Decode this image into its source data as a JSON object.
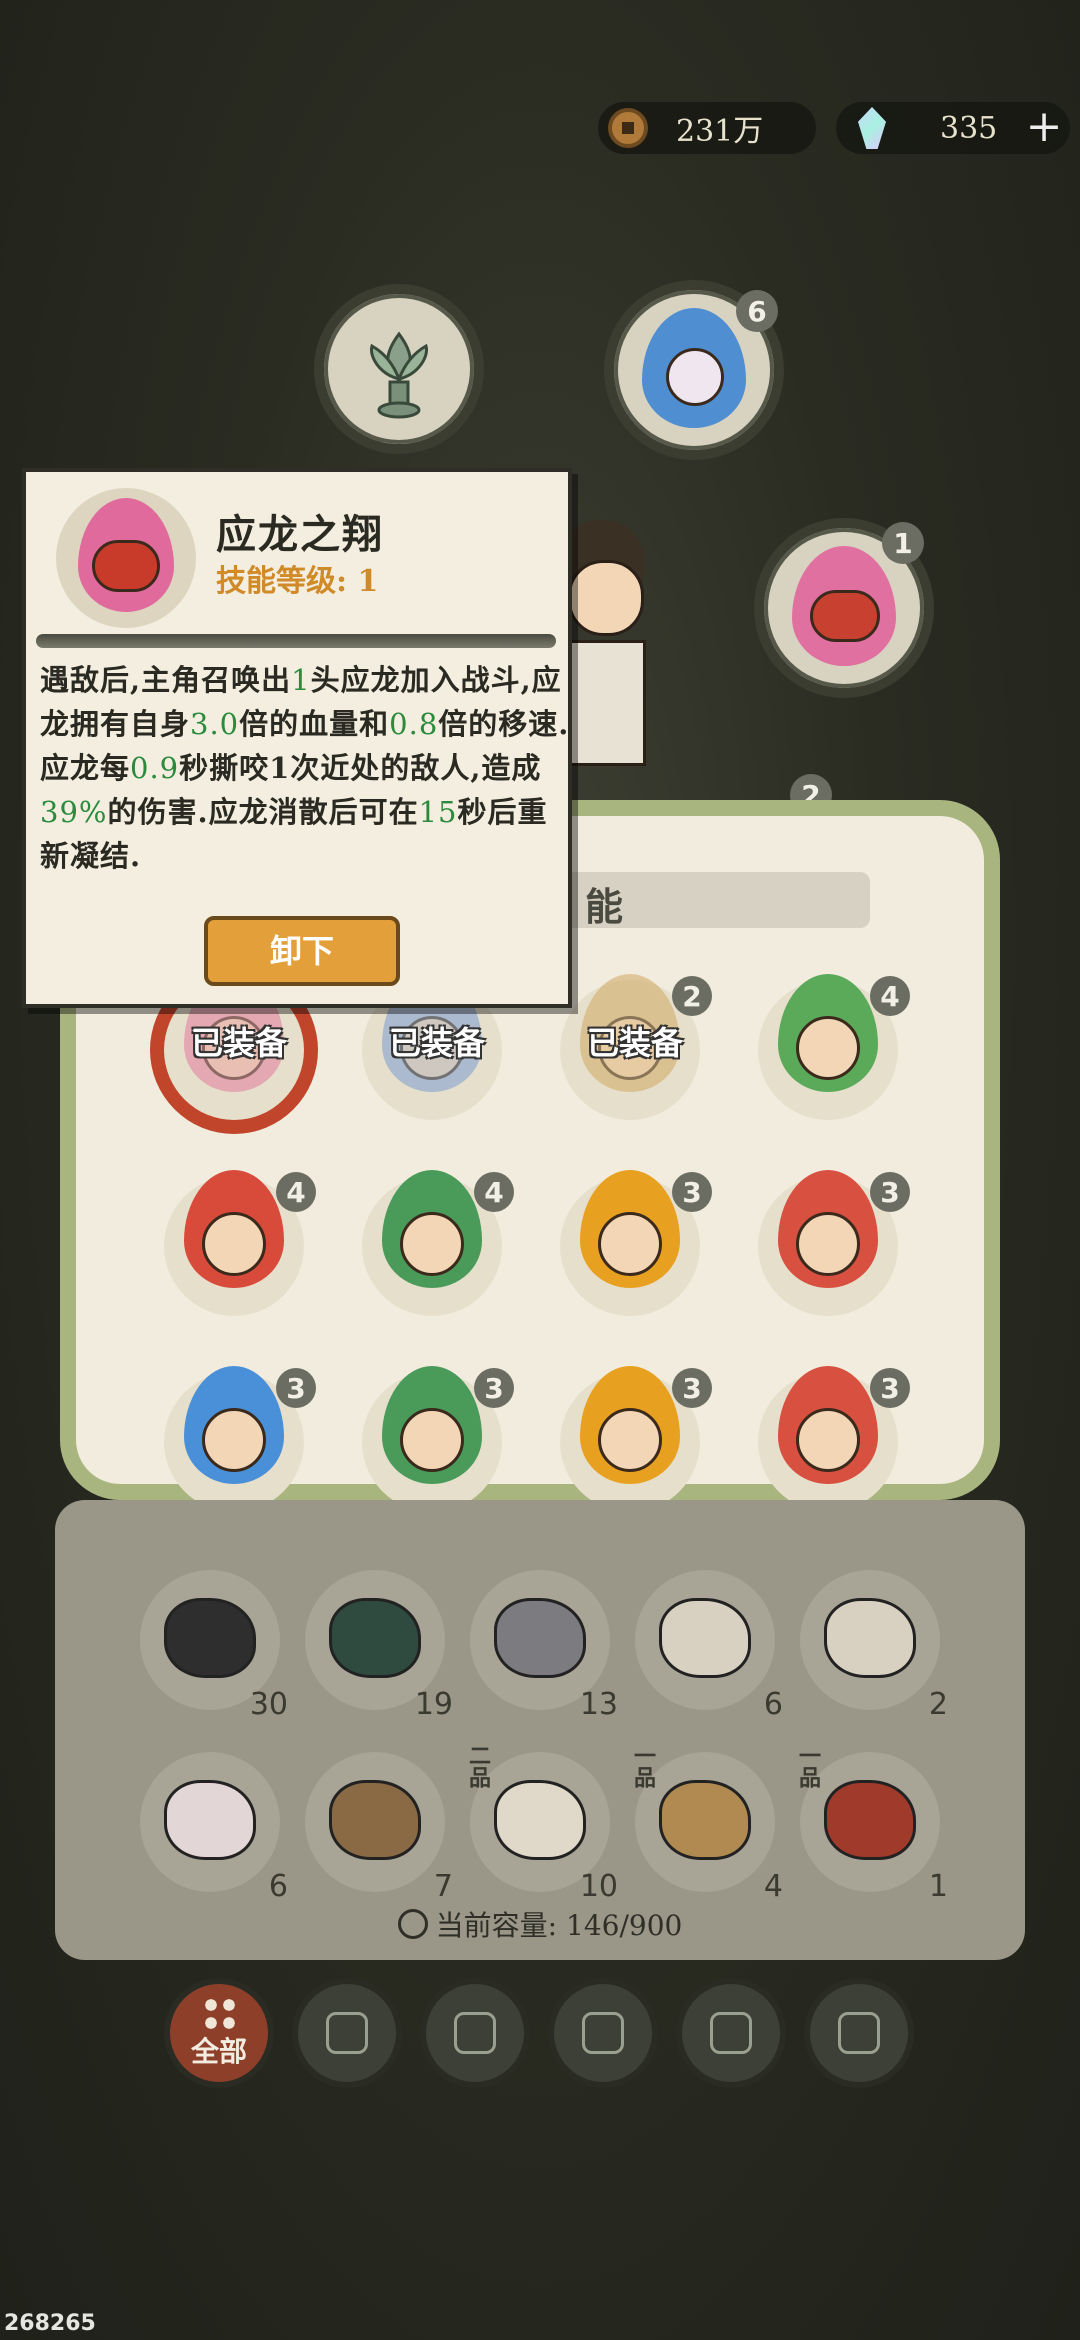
{
  "currency": {
    "coins": "231万",
    "gems": "335",
    "plus_label": "+"
  },
  "equipped_slots": [
    {
      "name": "lotus-slot",
      "level": ""
    },
    {
      "name": "blue-spirit-slot",
      "level": "6"
    },
    {
      "name": "dragon-slot",
      "level": "1"
    },
    {
      "name": "partial-slot",
      "level": "2"
    }
  ],
  "tooltip": {
    "name": "应龙之翔",
    "level_label": "技能等级: 1",
    "desc": [
      {
        "t": "遇敌后,主角召唤出"
      },
      {
        "t": "1",
        "g": true
      },
      {
        "t": "头应龙加入战斗,应龙拥有自身"
      },
      {
        "t": "3.0",
        "g": true
      },
      {
        "t": "倍的血量和"
      },
      {
        "t": "0.8",
        "g": true
      },
      {
        "t": "倍的移速.应龙每"
      },
      {
        "t": "0.9",
        "g": true
      },
      {
        "t": "秒撕咬1次近处的敌人,造成"
      },
      {
        "t": "39%",
        "g": true
      },
      {
        "t": "的伤害.应龙消散后可在"
      },
      {
        "t": "15",
        "g": true
      },
      {
        "t": "秒后重新凝结."
      }
    ],
    "unequip_label": "卸下"
  },
  "skills_panel": {
    "title_partial": "能"
  },
  "skills": [
    {
      "color": "#e07a9a",
      "level": "",
      "equipped": "已装备",
      "ring": true
    },
    {
      "color": "#7a9ad0",
      "level": "",
      "equipped": "已装备"
    },
    {
      "color": "#d0a860",
      "level": "2",
      "equipped": "已装备"
    },
    {
      "color": "#5aaa5a",
      "level": "4"
    },
    {
      "color": "#d84a3a",
      "level": "4"
    },
    {
      "color": "#4a9a5a",
      "level": "4"
    },
    {
      "color": "#e8a020",
      "level": "3"
    },
    {
      "color": "#d85040",
      "level": "3"
    },
    {
      "color": "#4a90d8",
      "level": "3"
    },
    {
      "color": "#4a9a5a",
      "level": "3"
    },
    {
      "color": "#e8a020",
      "level": "3"
    },
    {
      "color": "#d85040",
      "level": "3"
    }
  ],
  "items": [
    {
      "name": "coal-ore",
      "count": "30",
      "grade": "",
      "color": "#2e2e2e"
    },
    {
      "name": "green-ore",
      "count": "19",
      "grade": "",
      "color": "#2f4a3e"
    },
    {
      "name": "crystal-ore",
      "count": "13",
      "grade": "",
      "color": "#7c7c80"
    },
    {
      "name": "meat-dumpling",
      "count": "6",
      "grade": "",
      "color": "#d8d0c0"
    },
    {
      "name": "veggie-dumpling",
      "count": "2",
      "grade": "",
      "color": "#d8d0c0"
    },
    {
      "name": "pork-dumpling",
      "count": "6",
      "grade": "",
      "color": "#e2d6d6"
    },
    {
      "name": "wood-log",
      "count": "7",
      "grade": "",
      "color": "#8a6a44"
    },
    {
      "name": "eggs-on-leaf",
      "count": "10",
      "grade": "二品",
      "color": "#e0d8c8"
    },
    {
      "name": "rope",
      "count": "4",
      "grade": "一品",
      "color": "#b08a50"
    },
    {
      "name": "thread-spool",
      "count": "1",
      "grade": "一品",
      "color": "#a03a2a"
    }
  ],
  "capacity_label": "当前容量: 146/900",
  "filters": [
    {
      "name": "all",
      "label": "全部",
      "icon": "grid-icon",
      "active": true
    },
    {
      "name": "wood",
      "label": "",
      "icon": "log-icon"
    },
    {
      "name": "building",
      "label": "",
      "icon": "hut-icon"
    },
    {
      "name": "plant",
      "label": "",
      "icon": "leaf-icon"
    },
    {
      "name": "food",
      "label": "",
      "icon": "rice-bowl-icon"
    },
    {
      "name": "scroll",
      "label": "",
      "icon": "scroll-icon"
    }
  ],
  "build_id": "268265",
  "colors": {
    "accent": "#e3a03a",
    "panel_border": "#a8b57f",
    "highlight_green": "#2c8a3c"
  }
}
